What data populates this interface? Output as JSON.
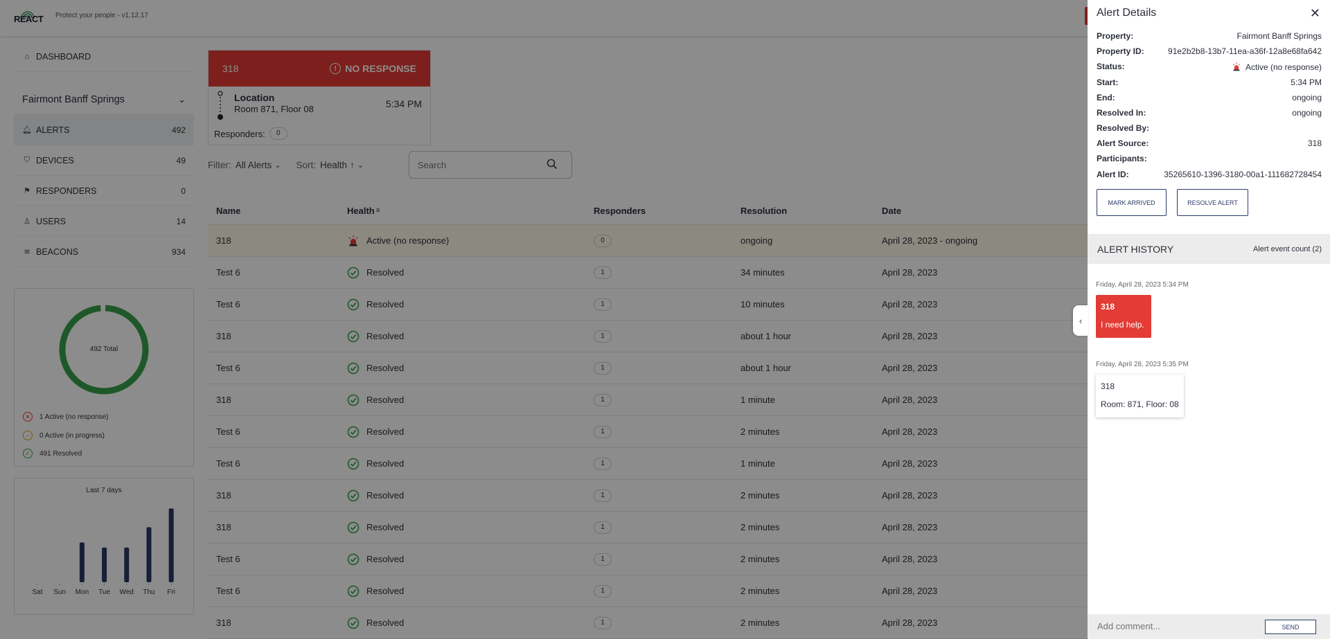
{
  "header": {
    "logo_text": "REACT",
    "version": "Protect your people - v1.12.17"
  },
  "sidebar": {
    "dashboard_label": "DASHBOARD",
    "property": "Fairmont Banff Springs",
    "items": [
      {
        "label": "ALERTS",
        "count": "492",
        "icon": "bell-icon"
      },
      {
        "label": "DEVICES",
        "count": "49",
        "icon": "shield-icon"
      },
      {
        "label": "RESPONDERS",
        "count": "0",
        "icon": "runner-icon"
      },
      {
        "label": "USERS",
        "count": "14",
        "icon": "user-icon"
      },
      {
        "label": "BEACONS",
        "count": "934",
        "icon": "wifi-icon"
      }
    ],
    "summary": {
      "total_label": "492 Total",
      "active_no_response": "1 Active (no response)",
      "active_in_progress": "0 Active (in progress)",
      "resolved": "491 Resolved",
      "colors": {
        "resolved": "#3aa14a",
        "no_response": "#e33b35",
        "in_progress": "#e0a020"
      }
    }
  },
  "chart_data": {
    "type": "bar",
    "title": "Last 7 days",
    "categories": [
      "Sat",
      "Sun",
      "Mon",
      "Tue",
      "Wed",
      "Thu",
      "Fri"
    ],
    "values": [
      0,
      0,
      55,
      48,
      48,
      76,
      102
    ],
    "ylim": [
      0,
      110
    ],
    "bar_color": "#2b3a67"
  },
  "alert_card": {
    "number": "318",
    "state": "NO RESPONSE",
    "location_title": "Location",
    "location_sub": "Room 871, Floor 08",
    "time": "5:34 PM",
    "responders_label": "Responders:",
    "responders_count": "0"
  },
  "filters": {
    "filter_label": "Filter:",
    "filter_value": "All Alerts",
    "sort_label": "Sort:",
    "sort_value": "Health",
    "search_placeholder": "Search"
  },
  "table": {
    "columns": [
      "Name",
      "Health",
      "Responders",
      "Resolution",
      "Date"
    ],
    "rows": [
      {
        "name": "318",
        "health": "Active (no response)",
        "status": "active",
        "responders": "0",
        "resolution": "ongoing",
        "date": "April 28, 2023 - ongoing"
      },
      {
        "name": "Test 6",
        "health": "Resolved",
        "status": "resolved",
        "responders": "1",
        "resolution": "34 minutes",
        "date": "April 28, 2023"
      },
      {
        "name": "Test 6",
        "health": "Resolved",
        "status": "resolved",
        "responders": "1",
        "resolution": "10 minutes",
        "date": "April 28, 2023"
      },
      {
        "name": "318",
        "health": "Resolved",
        "status": "resolved",
        "responders": "1",
        "resolution": "about 1 hour",
        "date": "April 28, 2023"
      },
      {
        "name": "Test 6",
        "health": "Resolved",
        "status": "resolved",
        "responders": "1",
        "resolution": "about 1 hour",
        "date": "April 28, 2023"
      },
      {
        "name": "318",
        "health": "Resolved",
        "status": "resolved",
        "responders": "1",
        "resolution": "1 minute",
        "date": "April 28, 2023"
      },
      {
        "name": "Test 6",
        "health": "Resolved",
        "status": "resolved",
        "responders": "1",
        "resolution": "2 minutes",
        "date": "April 28, 2023"
      },
      {
        "name": "Test 6",
        "health": "Resolved",
        "status": "resolved",
        "responders": "1",
        "resolution": "1 minute",
        "date": "April 28, 2023"
      },
      {
        "name": "318",
        "health": "Resolved",
        "status": "resolved",
        "responders": "1",
        "resolution": "2 minutes",
        "date": "April 28, 2023"
      },
      {
        "name": "318",
        "health": "Resolved",
        "status": "resolved",
        "responders": "1",
        "resolution": "2 minutes",
        "date": "April 28, 2023"
      },
      {
        "name": "Test 6",
        "health": "Resolved",
        "status": "resolved",
        "responders": "1",
        "resolution": "2 minutes",
        "date": "April 28, 2023"
      },
      {
        "name": "Test 6",
        "health": "Resolved",
        "status": "resolved",
        "responders": "1",
        "resolution": "2 minutes",
        "date": "April 28, 2023"
      },
      {
        "name": "318",
        "health": "Resolved",
        "status": "resolved",
        "responders": "1",
        "resolution": "2 minutes",
        "date": "April 28, 2023"
      }
    ]
  },
  "panel": {
    "title": "Alert Details",
    "details": [
      {
        "key": "Property:",
        "value": "Fairmont Banff Springs"
      },
      {
        "key": "Property ID:",
        "value": "91e2b2b8-13b7-11ea-a36f-12a8e68fa642"
      },
      {
        "key": "Status:",
        "value": "Active (no response)"
      },
      {
        "key": "Start:",
        "value": "5:34 PM"
      },
      {
        "key": "End:",
        "value": "ongoing"
      },
      {
        "key": "Resolved In:",
        "value": "ongoing"
      },
      {
        "key": "Resolved By:",
        "value": ""
      },
      {
        "key": "Alert Source:",
        "value": "318"
      },
      {
        "key": "Participants:",
        "value": ""
      },
      {
        "key": "Alert ID:",
        "value": "35265610-1396-3180-00a1-111682728454"
      }
    ],
    "mark_arrived": "MARK ARRIVED",
    "resolve_alert": "RESOLVE ALERT",
    "history_title": "ALERT HISTORY",
    "history_count": "Alert event count (2)",
    "events": [
      {
        "date": "Friday, April 28, 2023 5:34 PM",
        "title": "318",
        "body": "I need help."
      },
      {
        "date": "Friday, April 28, 2023 5:35 PM",
        "title": "318",
        "body": "Room: 871, Floor: 08"
      }
    ],
    "comment_placeholder": "Add comment...",
    "send_label": "SEND"
  }
}
